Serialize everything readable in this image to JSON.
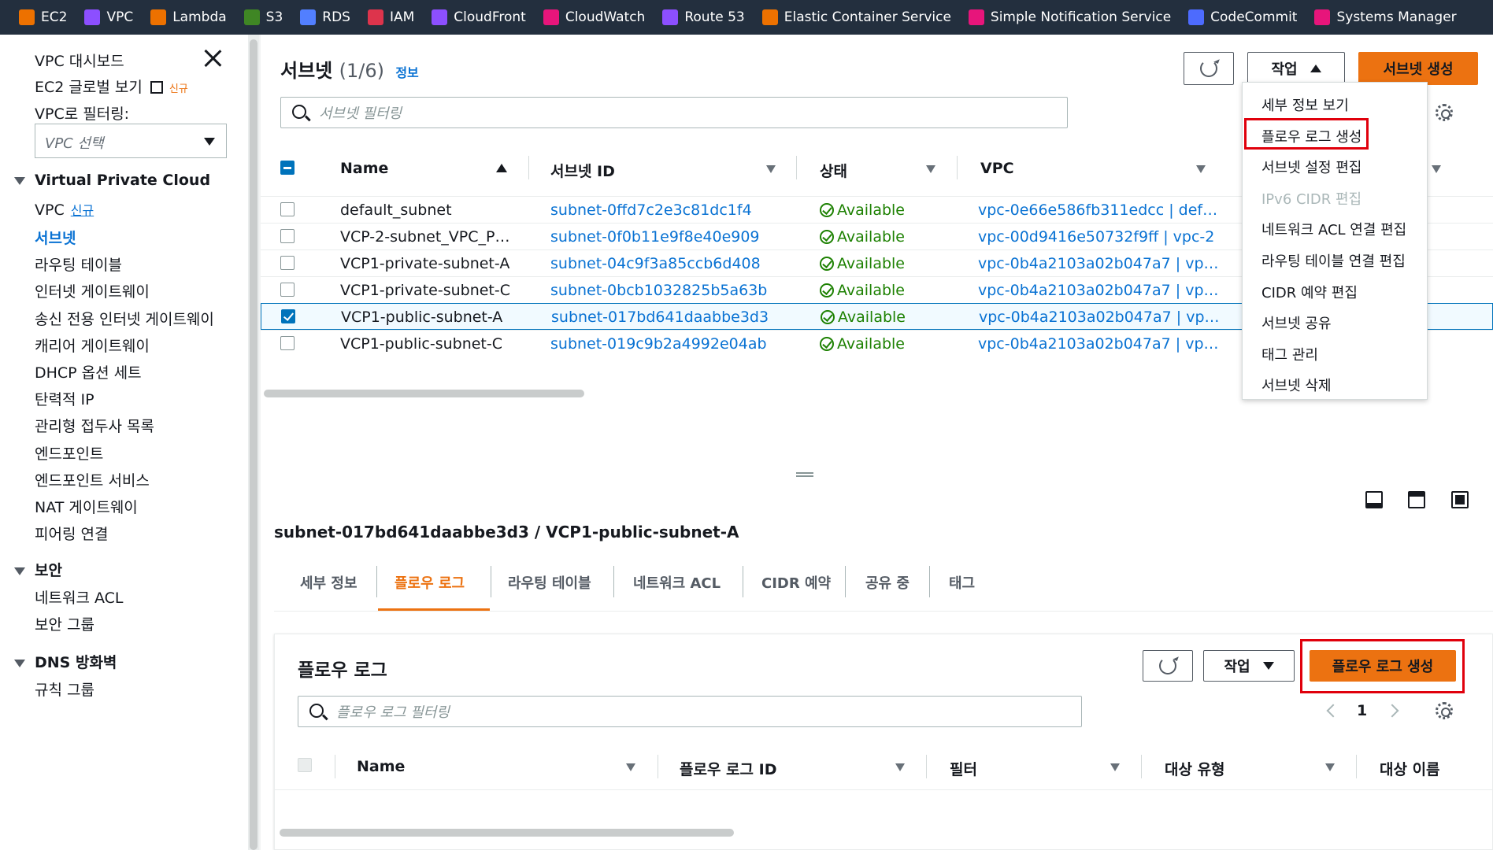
{
  "topbar": {
    "services": [
      {
        "label": "EC2",
        "icon": "ec2-icon",
        "color": "#ed7100"
      },
      {
        "label": "VPC",
        "icon": "vpc-icon",
        "color": "#8c4fff"
      },
      {
        "label": "Lambda",
        "icon": "lambda-icon",
        "color": "#ed7100"
      },
      {
        "label": "S3",
        "icon": "s3-icon",
        "color": "#3f8624"
      },
      {
        "label": "RDS",
        "icon": "rds-icon",
        "color": "#527fff"
      },
      {
        "label": "IAM",
        "icon": "iam-icon",
        "color": "#dd344c"
      },
      {
        "label": "CloudFront",
        "icon": "cloudfront-icon",
        "color": "#8c4fff"
      },
      {
        "label": "CloudWatch",
        "icon": "cloudwatch-icon",
        "color": "#e7157b"
      },
      {
        "label": "Route 53",
        "icon": "route53-icon",
        "color": "#8c4fff"
      },
      {
        "label": "Elastic Container Service",
        "icon": "ecs-icon",
        "color": "#ed7100"
      },
      {
        "label": "Simple Notification Service",
        "icon": "sns-icon",
        "color": "#e7157b"
      },
      {
        "label": "CodeCommit",
        "icon": "codecommit-icon",
        "color": "#4d6bfe"
      },
      {
        "label": "Systems Manager",
        "icon": "systems-manager-icon",
        "color": "#e7157b"
      }
    ]
  },
  "sidebar": {
    "dashboard": "VPC 대시보드",
    "ec2_global": "EC2 글로벌 보기",
    "ec2_global_badge": "신규",
    "filter_label": "VPC로 필터링:",
    "vpc_select_placeholder": "VPC 선택",
    "section_vpc": "Virtual Private Cloud",
    "vpc_item": "VPC",
    "vpc_new": "신규",
    "items_vpc": [
      "서브넷",
      "라우팅 테이블",
      "인터넷 게이트웨이",
      "송신 전용 인터넷 게이트웨이",
      "캐리어 게이트웨이",
      "DHCP 옵션 세트",
      "탄력적 IP",
      "관리형 접두사 목록",
      "엔드포인트",
      "엔드포인트 서비스",
      "NAT 게이트웨이",
      "피어링 연결"
    ],
    "section_security": "보안",
    "items_security": [
      "네트워크 ACL",
      "보안 그룹"
    ],
    "section_dns": "DNS 방화벽",
    "items_dns": [
      "규칙 그룹"
    ]
  },
  "subnets": {
    "title": "서브넷",
    "count": "(1/6)",
    "info": "정보",
    "actions_label": "작업",
    "create_label": "서브넷 생성",
    "filter_placeholder": "서브넷 필터링",
    "columns": [
      "Name",
      "서브넷 ID",
      "상태",
      "VPC"
    ],
    "rows": [
      {
        "name": "default_subnet",
        "id": "subnet-0ffd7c2e3c81dc1f4",
        "status": "Available",
        "vpc": "vpc-0e66e586fb311edcc | def…",
        "checked": false
      },
      {
        "name": "VCP-2-subnet_VPC_P…",
        "id": "subnet-0f0b11e9f8e40e909",
        "status": "Available",
        "vpc": "vpc-00d9416e50732f9ff | vpc-2",
        "checked": false
      },
      {
        "name": "VCP1-private-subnet-A",
        "id": "subnet-04c9f3a85ccb6d408",
        "status": "Available",
        "vpc": "vpc-0b4a2103a02b047a7 | vp…",
        "checked": false
      },
      {
        "name": "VCP1-private-subnet-C",
        "id": "subnet-0bcb1032825b5a63b",
        "status": "Available",
        "vpc": "vpc-0b4a2103a02b047a7 | vp…",
        "checked": false
      },
      {
        "name": "VCP1-public-subnet-A",
        "id": "subnet-017bd641daabbe3d3",
        "status": "Available",
        "vpc": "vpc-0b4a2103a02b047a7 | vp…",
        "checked": true
      },
      {
        "name": "VCP1-public-subnet-C",
        "id": "subnet-019c9b2a4992e04ab",
        "status": "Available",
        "vpc": "vpc-0b4a2103a02b047a7 | vp…",
        "checked": false
      }
    ]
  },
  "actions_menu": {
    "items": [
      "세부 정보 보기",
      "플로우 로그 생성",
      "서브넷 설정 편집",
      "IPv6 CIDR 편집",
      "네트워크 ACL 연결 편집",
      "라우팅 테이블 연결 편집",
      "CIDR 예약 편집",
      "서브넷 공유",
      "태그 관리",
      "서브넷 삭제"
    ],
    "disabled_index": 3,
    "highlighted_index": 1
  },
  "detail": {
    "heading": "subnet-017bd641daabbe3d3 / VCP1-public-subnet-A",
    "tabs": [
      "세부 정보",
      "플로우 로그",
      "라우팅 테이블",
      "네트워크 ACL",
      "CIDR 예약",
      "공유 중",
      "태그"
    ],
    "active_tab": 1,
    "flowlogs": {
      "title": "플로우 로그",
      "actions_label": "작업",
      "create_label": "플로우 로그 생성",
      "filter_placeholder": "플로우 로그 필터링",
      "page": "1",
      "columns": [
        "Name",
        "플로우 로그 ID",
        "필터",
        "대상 유형",
        "대상 이름"
      ]
    }
  },
  "colors": {
    "accent": "#ec7211",
    "link": "#0972d3",
    "ok": "#1d8102",
    "highlight": "#e0000c",
    "nav": "#232f3e"
  }
}
